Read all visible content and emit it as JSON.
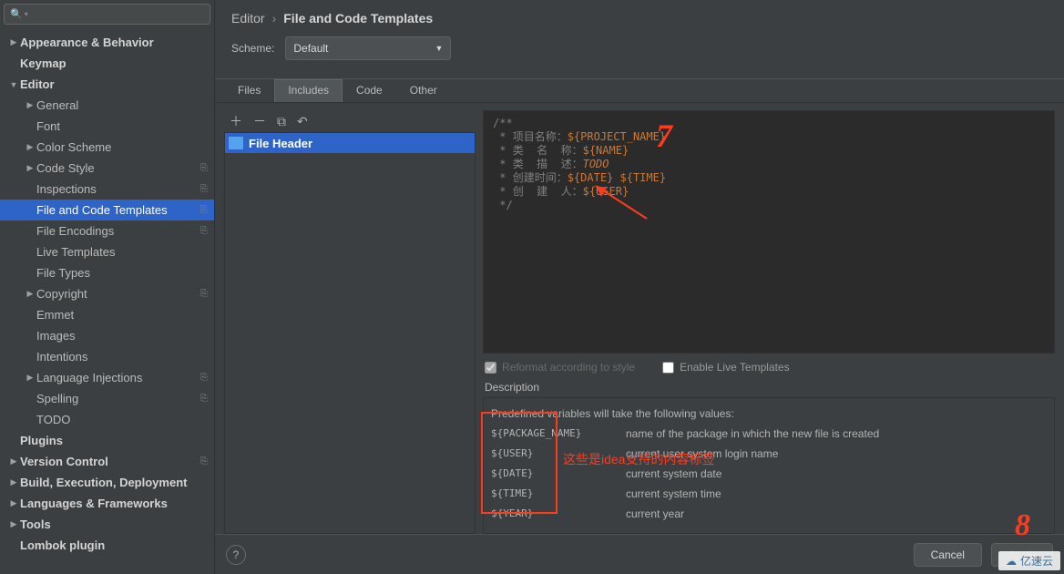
{
  "search": {
    "placeholder": ""
  },
  "tree": [
    {
      "label": "Appearance & Behavior",
      "indent": 0,
      "expander": "▶",
      "bold": true
    },
    {
      "label": "Keymap",
      "indent": 0,
      "expander": "",
      "bold": true
    },
    {
      "label": "Editor",
      "indent": 0,
      "expander": "▼",
      "bold": true
    },
    {
      "label": "General",
      "indent": 1,
      "expander": "▶"
    },
    {
      "label": "Font",
      "indent": 1,
      "expander": ""
    },
    {
      "label": "Color Scheme",
      "indent": 1,
      "expander": "▶"
    },
    {
      "label": "Code Style",
      "indent": 1,
      "expander": "▶",
      "badge": true
    },
    {
      "label": "Inspections",
      "indent": 1,
      "expander": "",
      "badge": true
    },
    {
      "label": "File and Code Templates",
      "indent": 1,
      "expander": "",
      "badge": true,
      "selected": true
    },
    {
      "label": "File Encodings",
      "indent": 1,
      "expander": "",
      "badge": true
    },
    {
      "label": "Live Templates",
      "indent": 1,
      "expander": ""
    },
    {
      "label": "File Types",
      "indent": 1,
      "expander": ""
    },
    {
      "label": "Copyright",
      "indent": 1,
      "expander": "▶",
      "badge": true
    },
    {
      "label": "Emmet",
      "indent": 1,
      "expander": ""
    },
    {
      "label": "Images",
      "indent": 1,
      "expander": ""
    },
    {
      "label": "Intentions",
      "indent": 1,
      "expander": ""
    },
    {
      "label": "Language Injections",
      "indent": 1,
      "expander": "▶",
      "badge": true
    },
    {
      "label": "Spelling",
      "indent": 1,
      "expander": "",
      "badge": true
    },
    {
      "label": "TODO",
      "indent": 1,
      "expander": ""
    },
    {
      "label": "Plugins",
      "indent": 0,
      "expander": "",
      "bold": true
    },
    {
      "label": "Version Control",
      "indent": 0,
      "expander": "▶",
      "bold": true,
      "badge": true
    },
    {
      "label": "Build, Execution, Deployment",
      "indent": 0,
      "expander": "▶",
      "bold": true
    },
    {
      "label": "Languages & Frameworks",
      "indent": 0,
      "expander": "▶",
      "bold": true
    },
    {
      "label": "Tools",
      "indent": 0,
      "expander": "▶",
      "bold": true
    },
    {
      "label": "Lombok plugin",
      "indent": 0,
      "expander": "",
      "bold": true
    }
  ],
  "breadcrumbs": {
    "a": "Editor",
    "sep": "›",
    "b": "File and Code Templates"
  },
  "scheme": {
    "label": "Scheme:",
    "value": "Default"
  },
  "tabs": [
    "Files",
    "Includes",
    "Code",
    "Other"
  ],
  "active_tab": 1,
  "file_list": {
    "item": "File Header"
  },
  "editor_lines": [
    [
      {
        "t": "/**",
        "c": "cm-star"
      }
    ],
    [
      {
        "t": " * ",
        "c": "cm-star"
      },
      {
        "t": "项目名称：",
        "c": "cm-key"
      },
      {
        "t": "${PROJECT_NAME}",
        "c": "cm-macro"
      }
    ],
    [
      {
        "t": " * ",
        "c": "cm-star"
      },
      {
        "t": "类  名  称：",
        "c": "cm-key"
      },
      {
        "t": "${NAME}",
        "c": "cm-macro"
      }
    ],
    [
      {
        "t": " * ",
        "c": "cm-star"
      },
      {
        "t": "类  描  述：",
        "c": "cm-key"
      },
      {
        "t": "TODO",
        "c": "cm-todo"
      }
    ],
    [
      {
        "t": " * ",
        "c": "cm-star"
      },
      {
        "t": "创建时间：",
        "c": "cm-key"
      },
      {
        "t": "${DATE} ${TIME}",
        "c": "cm-macro"
      }
    ],
    [
      {
        "t": " * ",
        "c": "cm-star"
      },
      {
        "t": "创  建  人：",
        "c": "cm-key"
      },
      {
        "t": "${USER}",
        "c": "cm-macro"
      }
    ],
    [
      {
        "t": " */",
        "c": "cm-star"
      }
    ]
  ],
  "options": {
    "reformat": "Reformat according to style",
    "live": "Enable Live Templates"
  },
  "description": {
    "title": "Description",
    "intro": "Predefined variables will take the following values:",
    "vars": [
      {
        "k": "${PACKAGE_NAME}",
        "v": "name of the package in which the new file is created"
      },
      {
        "k": "${USER}",
        "v": "current user system login name"
      },
      {
        "k": "${DATE}",
        "v": "current system date"
      },
      {
        "k": "${TIME}",
        "v": "current system time"
      },
      {
        "k": "${YEAR}",
        "v": "current year"
      }
    ]
  },
  "footer": {
    "help": "?",
    "cancel": "Cancel",
    "apply": "Apply"
  },
  "annotations": {
    "seven": "7",
    "eight": "8",
    "cn": "这些是idea支持的内容标签"
  },
  "watermark": "亿速云"
}
